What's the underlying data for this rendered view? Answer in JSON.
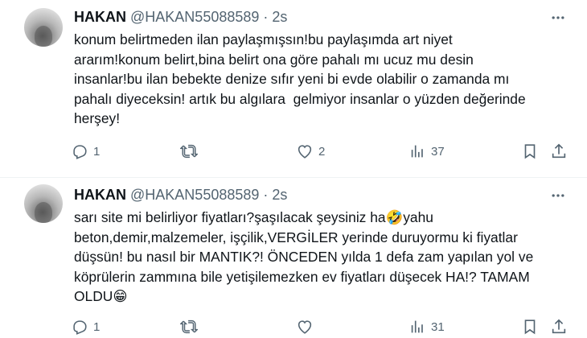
{
  "tweets": [
    {
      "name": "HAKAN",
      "handle": "@HAKAN55088589",
      "separator": "·",
      "time": "2s",
      "lines": [
        "konum belirtmeden ilan paylaşmışsın!bu paylaşımda art niyet",
        "ararım!konum belirt,bina belirt ona göre pahalı mı ucuz mu desin",
        "insanlar!bu ilan bebekte denize sıfır yeni bi evde olabilir o zamanda mı",
        "pahalı diyeceksin! artık bu algılara  gelmiyor insanlar o yüzden değerinde",
        "herşey!"
      ],
      "replies": "1",
      "retweets": "",
      "likes": "2",
      "views": "37"
    },
    {
      "name": "HAKAN",
      "handle": "@HAKAN55088589",
      "separator": "·",
      "time": "2s",
      "lines": [
        "sarı site mi belirliyor fiyatları?şaşılacak şeysiniz ha🤣yahu",
        "beton,demir,malzemeler, işçilik,VERGİLER yerinde duruyormu ki fiyatlar",
        "düşsün! bu nasıl bir MANTIK?! ÖNCEDEN yılda 1 defa zam yapılan yol ve",
        "köprülerin zammına bile yetişilemezken ev fiyatları düşecek HA!? TAMAM",
        "OLDU😁"
      ],
      "replies": "1",
      "retweets": "",
      "likes": "",
      "views": "31"
    }
  ],
  "icons": {
    "more": "more-horizontal-icon",
    "reply": "reply-icon",
    "retweet": "retweet-icon",
    "like": "heart-icon",
    "views": "views-chart-icon",
    "bookmark": "bookmark-icon",
    "share": "share-icon"
  },
  "colors": {
    "text": "#0f1419",
    "secondary": "#536471",
    "divider": "#eff3f4"
  }
}
